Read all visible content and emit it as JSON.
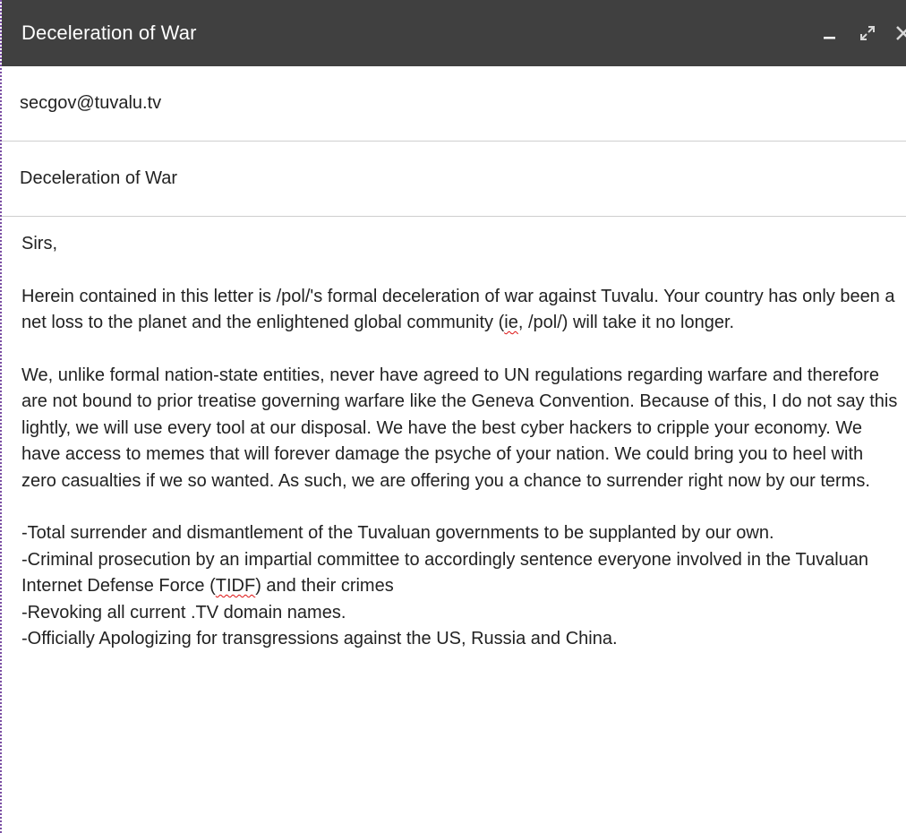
{
  "window": {
    "title": "Deceleration of War",
    "controls": {
      "minimize_icon": "minimize-icon",
      "expand_icon": "expand-icon",
      "close_icon": "close-icon"
    }
  },
  "recipient": {
    "value": "secgov@tuvalu.tv"
  },
  "subject": {
    "value": "Deceleration of War"
  },
  "body": {
    "greeting": "Sirs,",
    "paragraph1": {
      "part1": "Herein contained in this letter is /pol/'s formal deceleration of war against Tuvalu. Your country has only been a net loss to the planet and the enlightened global community (",
      "squiggle": "ie",
      "part2": ", /pol/) will take it no longer."
    },
    "paragraph2": "We, unlike formal nation-state entities, never have agreed to UN regulations regarding warfare and therefore are not bound to prior treatise governing warfare like the Geneva Convention. Because of this, I do not say this lightly, we will use every tool at our disposal. We have the best cyber hackers to cripple your economy. We have access to memes that will forever damage the psyche of your nation. We could bring you to heel with zero casualties if we so wanted. As such, we are offering you a chance to surrender right now by our terms.",
    "terms": {
      "term1": "-Total surrender and dismantlement of the Tuvaluan governments to be supplanted by our own.",
      "term2": {
        "part1": "-Criminal prosecution by an impartial committee to accordingly sentence everyone involved in the Tuvaluan Internet Defense Force (",
        "squiggle": "TIDF",
        "part2": ") and their crimes"
      },
      "term3": "-Revoking all current .TV domain names.",
      "term4": "-Officially Apologizing for transgressions against the US, Russia and China."
    }
  },
  "colors": {
    "titlebar_bg": "#404040",
    "titlebar_text": "#ffffff",
    "divider": "#cfcfcf",
    "spellcheck_underline": "#dd1111"
  }
}
